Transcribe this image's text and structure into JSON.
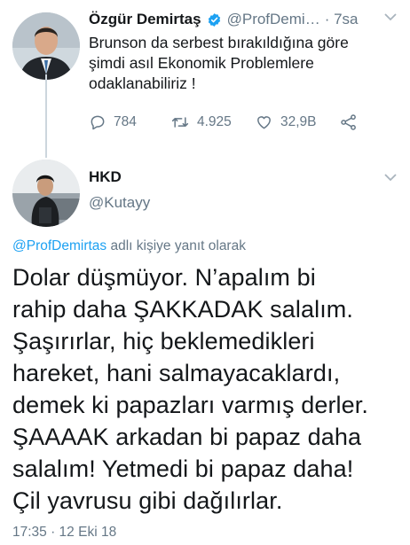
{
  "tweet1": {
    "name": "Özgür Demirtaş",
    "handle": "@ProfDemi…",
    "time": "· 7sa",
    "line1": "Brunson da serbest bırakıldığına göre",
    "line2": "şimdi asıl Ekonomik Problemlere",
    "line3": "odaklanabiliriz !",
    "replies": "784",
    "retweets": "4.925",
    "likes": "32,9B"
  },
  "tweet2": {
    "name": "HKD",
    "handle": "@Kutayy",
    "reply_link": "@ProfDemirtas",
    "reply_suffix": " adlı kişiye yanıt olarak",
    "lines": [
      "Dolar düşmüyor. N’apalım bi",
      "rahip daha ŞAKKADAK salalım.",
      "Şaşırırlar, hiç beklemedikleri",
      "hareket, hani salmayacaklardı,",
      "demek ki papazları varmış derler.",
      "ŞAAAAK arkadan bi papaz daha",
      "salalım! Yetmedi bi papaz daha!",
      "Çil yavrusu gibi dağılırlar."
    ],
    "timestamp": "17:35 · 12 Eki 18"
  },
  "colors": {
    "accent": "#1da1f2",
    "muted": "#657786",
    "verified": "#1da1f2"
  }
}
